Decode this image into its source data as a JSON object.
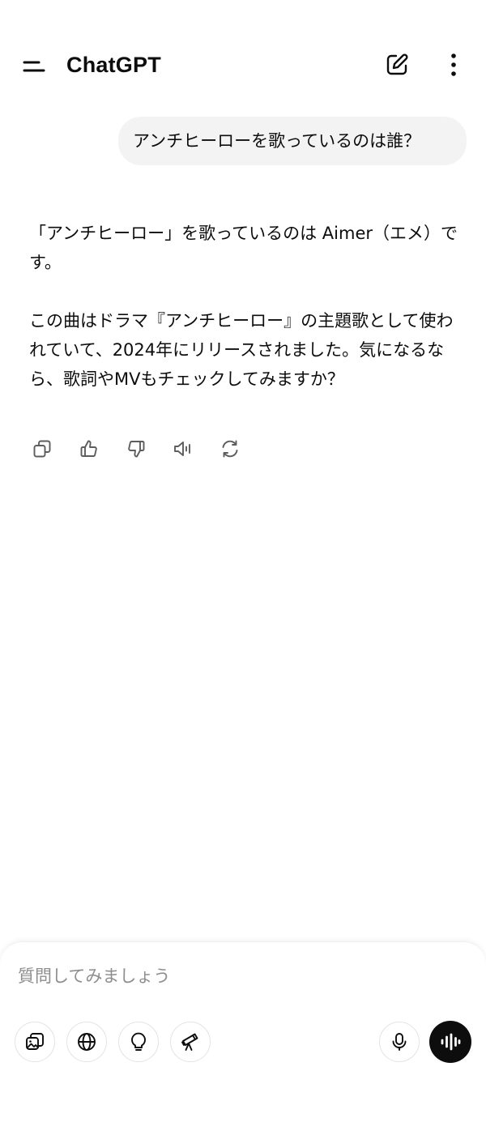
{
  "header": {
    "title": "ChatGPT",
    "icons": {
      "menu": "menu-icon",
      "compose": "edit-icon",
      "more": "more-vertical-icon"
    }
  },
  "conversation": {
    "user_message": "アンチヒーローを歌っているのは誰？",
    "assistant_paragraphs": [
      "「アンチヒーロー」を歌っているのは Aimer（エメ）です。",
      "この曲はドラマ『アンチヒーロー』の主題歌として使われていて、2024年にリリースされました。気になるなら、歌詞やMVもチェックしてみますか？"
    ],
    "actions": [
      "copy-icon",
      "thumbs-up-icon",
      "thumbs-down-icon",
      "speaker-icon",
      "regenerate-icon"
    ]
  },
  "composer": {
    "placeholder": "質問してみましょう",
    "tools": [
      "image-icon",
      "globe-icon",
      "lightbulb-icon",
      "telescope-icon"
    ],
    "mic": "microphone-icon",
    "voice": "voice-mode-icon"
  },
  "colors": {
    "text": "#0d0d0d",
    "bubble": "#f3f3f3",
    "placeholder": "#8e8e8e",
    "voice_button": "#0d0d0d"
  }
}
